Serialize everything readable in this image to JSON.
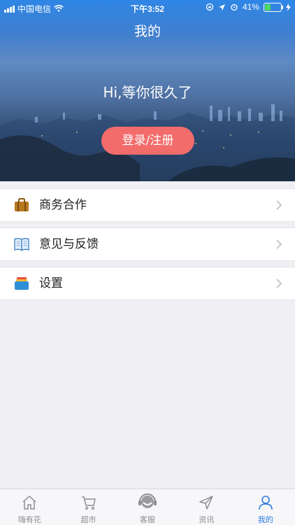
{
  "status_bar": {
    "carrier": "中国电信",
    "time": "下午3:52",
    "battery": "41%",
    "battery_level": 0.41
  },
  "header": {
    "title": "我的",
    "greeting": "Hi,等你很久了",
    "login_label": "登录/注册"
  },
  "menu": [
    {
      "label": "商务合作",
      "icon": "briefcase-icon"
    },
    {
      "label": "意见与反馈",
      "icon": "book-icon"
    },
    {
      "label": "设置",
      "icon": "settings-folder-icon"
    }
  ],
  "tabs": [
    {
      "label": "嗨有花",
      "icon": "home-icon",
      "active": false
    },
    {
      "label": "超市",
      "icon": "cart-icon",
      "active": false
    },
    {
      "label": "客服",
      "icon": "headset-icon",
      "active": false
    },
    {
      "label": "资讯",
      "icon": "send-icon",
      "active": false
    },
    {
      "label": "我的",
      "icon": "user-icon",
      "active": true
    }
  ],
  "colors": {
    "accent": "#2b7bdc",
    "login_button": "#f26c6c",
    "background": "#efeff4"
  }
}
